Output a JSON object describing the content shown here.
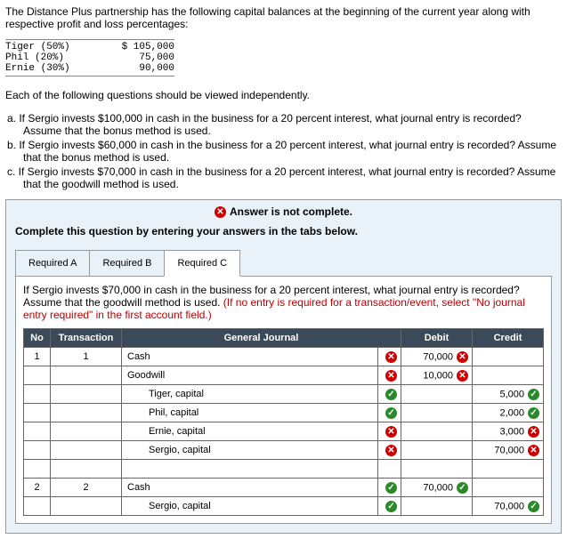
{
  "intro": "The Distance Plus partnership has the following capital balances at the beginning of the current year along with respective profit and loss percentages:",
  "balances": [
    {
      "name": "Tiger (50%)",
      "amount": "$ 105,000"
    },
    {
      "name": "Phil (20%)",
      "amount": "75,000"
    },
    {
      "name": "Ernie (30%)",
      "amount": "90,000"
    }
  ],
  "indep": "Each of the following questions should be viewed independently.",
  "parts": [
    "a. If Sergio invests $100,000 in cash in the business for a 20 percent interest, what journal entry is recorded? Assume that the bonus method is used.",
    "b. If Sergio invests $60,000 in cash in the business for a 20 percent interest, what journal entry is recorded? Assume that the bonus method is used.",
    "c. If Sergio invests $70,000 in cash in the business for a 20 percent interest, what journal entry is recorded? Assume that the goodwill method is used."
  ],
  "notComplete": "Answer is not complete.",
  "completeInstr": "Complete this question by entering your answers in the tabs below.",
  "tabs": {
    "a": "Required A",
    "b": "Required B",
    "c": "Required C"
  },
  "scenario": {
    "main": "If Sergio invests $70,000 in cash in the business for a 20 percent interest, what journal entry is recorded? Assume that the goodwill method is used. ",
    "hint": "(If no entry is required for a transaction/event, select \"No journal entry required\" in the first account field.)"
  },
  "headers": {
    "no": "No",
    "tx": "Transaction",
    "gj": "General Journal",
    "debit": "Debit",
    "credit": "Credit"
  },
  "rows": [
    {
      "no": "1",
      "tx": "1",
      "acct": "Cash",
      "indent": false,
      "mark": "bad",
      "debit": "70,000",
      "debitMark": "bad",
      "credit": "",
      "creditMark": ""
    },
    {
      "no": "",
      "tx": "",
      "acct": "Goodwill",
      "indent": false,
      "mark": "bad",
      "debit": "10,000",
      "debitMark": "bad",
      "credit": "",
      "creditMark": ""
    },
    {
      "no": "",
      "tx": "",
      "acct": "Tiger, capital",
      "indent": true,
      "mark": "ok",
      "debit": "",
      "debitMark": "",
      "credit": "5,000",
      "creditMark": "ok"
    },
    {
      "no": "",
      "tx": "",
      "acct": "Phil, capital",
      "indent": true,
      "mark": "ok",
      "debit": "",
      "debitMark": "",
      "credit": "2,000",
      "creditMark": "ok"
    },
    {
      "no": "",
      "tx": "",
      "acct": "Ernie, capital",
      "indent": true,
      "mark": "bad",
      "debit": "",
      "debitMark": "",
      "credit": "3,000",
      "creditMark": "bad"
    },
    {
      "no": "",
      "tx": "",
      "acct": "Sergio, capital",
      "indent": true,
      "mark": "bad",
      "debit": "",
      "debitMark": "",
      "credit": "70,000",
      "creditMark": "bad"
    },
    {
      "no": "",
      "tx": "",
      "acct": "",
      "indent": false,
      "mark": "",
      "debit": "",
      "debitMark": "",
      "credit": "",
      "creditMark": ""
    },
    {
      "no": "2",
      "tx": "2",
      "acct": "Cash",
      "indent": false,
      "mark": "ok",
      "debit": "70,000",
      "debitMark": "ok",
      "credit": "",
      "creditMark": ""
    },
    {
      "no": "",
      "tx": "",
      "acct": "Sergio, capital",
      "indent": true,
      "mark": "ok",
      "debit": "",
      "debitMark": "",
      "credit": "70,000",
      "creditMark": "ok"
    }
  ]
}
